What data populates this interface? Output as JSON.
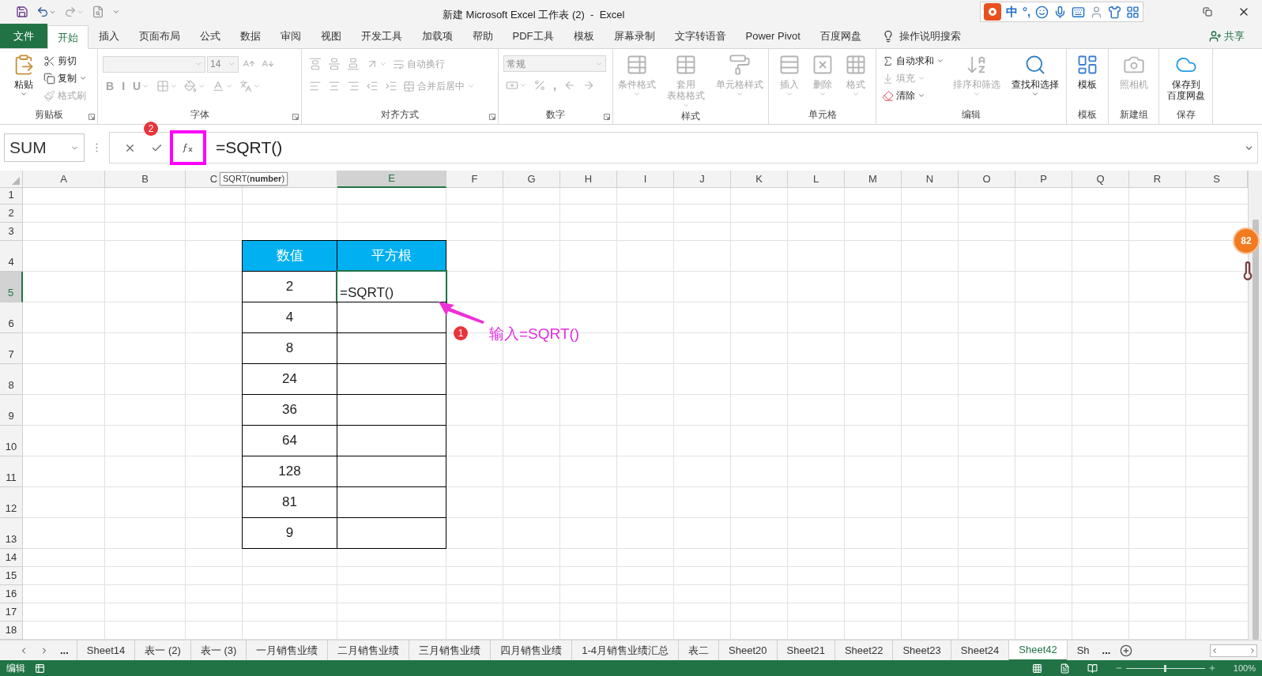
{
  "title_bar": {
    "title": "新建 Microsoft Excel 工作表 (2)  -  Excel"
  },
  "ime_toolbar": {
    "items": [
      "中",
      "°,"
    ]
  },
  "ribbon_tabs": [
    {
      "label": "文件",
      "kind": "file",
      "selected": false
    },
    {
      "label": "开始",
      "kind": "tab",
      "selected": true
    },
    {
      "label": "插入",
      "kind": "tab",
      "selected": false
    },
    {
      "label": "页面布局",
      "kind": "tab",
      "selected": false
    },
    {
      "label": "公式",
      "kind": "tab",
      "selected": false
    },
    {
      "label": "数据",
      "kind": "tab",
      "selected": false
    },
    {
      "label": "审阅",
      "kind": "tab",
      "selected": false
    },
    {
      "label": "视图",
      "kind": "tab",
      "selected": false
    },
    {
      "label": "开发工具",
      "kind": "tab",
      "selected": false
    },
    {
      "label": "加载项",
      "kind": "tab",
      "selected": false
    },
    {
      "label": "帮助",
      "kind": "tab",
      "selected": false
    },
    {
      "label": "PDF工具",
      "kind": "tab",
      "selected": false
    },
    {
      "label": "模板",
      "kind": "tab",
      "selected": false
    },
    {
      "label": "屏幕录制",
      "kind": "tab",
      "selected": false
    },
    {
      "label": "文字转语音",
      "kind": "tab",
      "selected": false
    },
    {
      "label": "Power Pivot",
      "kind": "tab",
      "selected": false
    },
    {
      "label": "百度网盘",
      "kind": "tab",
      "selected": false
    }
  ],
  "tell_me": "操作说明搜索",
  "share": "共享",
  "ribbon_groups": [
    {
      "label": "剪贴板",
      "items": [
        [
          {
            "kind": "large",
            "lines": [
              "粘贴"
            ],
            "disabled": false
          }
        ],
        [
          {
            "kind": "small",
            "label": "剪切",
            "disabled": false
          },
          {
            "kind": "small",
            "label": "复制",
            "disabled": false
          },
          {
            "kind": "small",
            "label": "格式刷",
            "disabled": true
          }
        ]
      ]
    },
    {
      "label": "字体",
      "items": [
        [
          {
            "kind": "field",
            "disabled": true
          },
          {
            "kind": "field",
            "value": "14",
            "disabled": true
          },
          {
            "kind": "icon",
            "disabled": true
          },
          {
            "kind": "icon",
            "disabled": true
          }
        ],
        [
          {
            "kind": "glyph",
            "label": "B",
            "disabled": true
          },
          {
            "kind": "glyph",
            "label": "I",
            "disabled": true
          },
          {
            "kind": "glyph",
            "label": "U",
            "disabled": true
          },
          {
            "kind": "icon",
            "disabled": true
          },
          {
            "kind": "icon",
            "disabled": true
          },
          {
            "kind": "icon",
            "disabled": true
          },
          {
            "kind": "icon",
            "disabled": true
          }
        ]
      ]
    },
    {
      "label": "对齐方式",
      "items": [
        [
          {
            "kind": "icon",
            "disabled": true
          },
          {
            "kind": "icon",
            "disabled": true
          },
          {
            "kind": "icon",
            "disabled": true
          },
          {
            "kind": "icon",
            "disabled": true
          },
          {
            "kind": "small",
            "label": "自动换行",
            "disabled": true
          }
        ],
        [
          {
            "kind": "icon",
            "disabled": true
          },
          {
            "kind": "icon",
            "disabled": true
          },
          {
            "kind": "icon",
            "disabled": true
          },
          {
            "kind": "icon",
            "disabled": true
          },
          {
            "kind": "icon",
            "disabled": true
          },
          {
            "kind": "small",
            "label": "合并后居中",
            "disabled": true
          }
        ]
      ]
    },
    {
      "label": "数字",
      "items": [
        [
          {
            "kind": "field",
            "value": "常规",
            "disabled": true
          }
        ],
        [
          {
            "kind": "icon",
            "disabled": true
          },
          {
            "kind": "icon",
            "disabled": true
          },
          {
            "kind": "glyph",
            "label": ",",
            "disabled": true
          },
          {
            "kind": "icon",
            "disabled": true
          },
          {
            "kind": "icon",
            "disabled": true
          }
        ]
      ]
    },
    {
      "label": "样式",
      "items": [
        [
          {
            "kind": "large",
            "lines": [
              "条件格式"
            ],
            "disabled": true
          }
        ],
        [
          {
            "kind": "large",
            "lines": [
              "套用",
              "表格格式"
            ],
            "disabled": true
          }
        ],
        [
          {
            "kind": "large",
            "lines": [
              "单元格样式"
            ],
            "disabled": true
          }
        ]
      ]
    },
    {
      "label": "单元格",
      "items": [
        [
          {
            "kind": "large",
            "lines": [
              "插入"
            ],
            "disabled": true
          }
        ],
        [
          {
            "kind": "large",
            "lines": [
              "删除"
            ],
            "disabled": true
          }
        ],
        [
          {
            "kind": "large",
            "lines": [
              "格式"
            ],
            "disabled": true
          }
        ]
      ]
    },
    {
      "label": "编辑",
      "items": [
        [
          {
            "kind": "small",
            "label": "自动求和",
            "disabled": false
          },
          {
            "kind": "small",
            "label": "填充",
            "disabled": true
          },
          {
            "kind": "small",
            "label": "清除",
            "disabled": false
          }
        ],
        [
          {
            "kind": "large",
            "lines": [
              "排序和筛选"
            ],
            "disabled": true
          }
        ],
        [
          {
            "kind": "large",
            "lines": [
              "查找和选择"
            ],
            "disabled": false
          }
        ]
      ]
    },
    {
      "label": "模板",
      "items": [
        [
          {
            "kind": "large",
            "lines": [
              "模板"
            ],
            "disabled": false
          }
        ]
      ]
    },
    {
      "label": "新建组",
      "items": [
        [
          {
            "kind": "large",
            "lines": [
              "照相机"
            ],
            "disabled": true
          }
        ]
      ]
    },
    {
      "label": "保存",
      "items": [
        [
          {
            "kind": "large",
            "lines": [
              "保存到",
              "百度网盘"
            ],
            "disabled": false
          }
        ]
      ]
    }
  ],
  "formula_bar": {
    "name_box": "SUM",
    "formula": "=SQRT()",
    "step_badge": "2"
  },
  "tooltip": "SQRT(**number**)",
  "columns": [
    {
      "label": "A",
      "selected": false
    },
    {
      "label": "B",
      "selected": false
    },
    {
      "label": "C",
      "selected": false
    },
    {
      "selected": false
    },
    {
      "label": "E",
      "selected": true
    },
    {
      "label": "F",
      "selected": false
    },
    {
      "label": "G",
      "selected": false
    },
    {
      "label": "H",
      "selected": false
    },
    {
      "label": "I",
      "selected": false
    },
    {
      "label": "J",
      "selected": false
    },
    {
      "label": "K",
      "selected": false
    },
    {
      "label": "L",
      "selected": false
    },
    {
      "label": "M",
      "selected": false
    },
    {
      "label": "N",
      "selected": false
    },
    {
      "label": "O",
      "selected": false
    },
    {
      "label": "P",
      "selected": false
    },
    {
      "label": "Q",
      "selected": false
    },
    {
      "label": "R",
      "selected": false
    },
    {
      "label": "S",
      "selected": false
    }
  ],
  "rows": [
    {
      "label": "1",
      "kind": "blank",
      "selected": false
    },
    {
      "label": "2",
      "kind": "blank",
      "selected": false
    },
    {
      "label": "3",
      "kind": "blank",
      "selected": false
    },
    {
      "label": "4",
      "kind": "header",
      "selected": false,
      "value": "数值",
      "result": "平方根"
    },
    {
      "label": "5",
      "kind": "data",
      "selected": true,
      "value": "2",
      "result": "=SQRT()"
    },
    {
      "label": "6",
      "kind": "data",
      "selected": false,
      "value": "4"
    },
    {
      "label": "7",
      "kind": "data",
      "selected": false,
      "value": "8"
    },
    {
      "label": "8",
      "kind": "data",
      "selected": false,
      "value": "24"
    },
    {
      "label": "9",
      "kind": "data",
      "selected": false,
      "value": "36"
    },
    {
      "label": "10",
      "kind": "data",
      "selected": false,
      "value": "64"
    },
    {
      "label": "11",
      "kind": "data",
      "selected": false,
      "value": "128"
    },
    {
      "label": "12",
      "kind": "data",
      "selected": false,
      "value": "81"
    },
    {
      "label": "13",
      "kind": "data",
      "selected": false,
      "value": "9"
    },
    {
      "label": "14",
      "kind": "blank",
      "selected": false
    },
    {
      "label": "15",
      "kind": "blank",
      "selected": false
    },
    {
      "label": "16",
      "kind": "blank",
      "selected": false
    },
    {
      "label": "17",
      "kind": "blank",
      "selected": false
    },
    {
      "label": "18",
      "kind": "blank",
      "selected": false
    }
  ],
  "annotation": {
    "badge": "1",
    "text": "输入=SQRT()"
  },
  "sheet_tabs": {
    "more_left": "...",
    "more_right": "...",
    "tabs": [
      {
        "label": "Sheet14",
        "selected": false
      },
      {
        "label": "表一 (2)",
        "selected": false
      },
      {
        "label": "表一 (3)",
        "selected": false
      },
      {
        "label": "一月销售业绩",
        "selected": false
      },
      {
        "label": "二月销售业绩",
        "selected": false
      },
      {
        "label": "三月销售业绩",
        "selected": false
      },
      {
        "label": "四月销售业绩",
        "selected": false
      },
      {
        "label": "1-4月销售业绩汇总",
        "selected": false
      },
      {
        "label": "表二",
        "selected": false
      },
      {
        "label": "Sheet20",
        "selected": false
      },
      {
        "label": "Sheet21",
        "selected": false
      },
      {
        "label": "Sheet22",
        "selected": false
      },
      {
        "label": "Sheet23",
        "selected": false
      },
      {
        "label": "Sheet24",
        "selected": false
      },
      {
        "label": "Sheet42",
        "selected": true
      },
      {
        "label": "Sh",
        "selected": false
      }
    ]
  },
  "status_bar": {
    "mode": "编辑",
    "zoom": "100%",
    "zoom_slider": {
      "level": 0.5
    }
  },
  "floating_badge": "82"
}
